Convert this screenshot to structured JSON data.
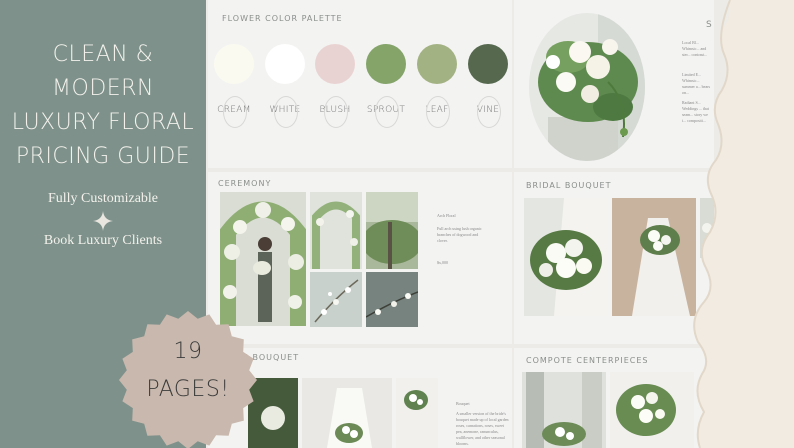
{
  "left_panel": {
    "title_lines": [
      "CLEAN & MODERN",
      "LUXURY FLORAL",
      "PRICING GUIDE"
    ],
    "tagline_1": "Fully Customizable",
    "tagline_2": "Book Luxury Clients",
    "background_color": "#7e918b"
  },
  "palette_page": {
    "heading": "FLOWER COLOR PALETTE",
    "swatches": [
      {
        "label": "CREAM",
        "color": "#fbfaf1"
      },
      {
        "label": "WHITE",
        "color": "#ffffff"
      },
      {
        "label": "BLUSH",
        "color": "#e9d3d2"
      },
      {
        "label": "SPROUT",
        "color": "#84a46a"
      },
      {
        "label": "LEAF",
        "color": "#a3b283"
      },
      {
        "label": "VINE",
        "color": "#56694f"
      }
    ]
  },
  "ceremony_page": {
    "heading": "CEREMONY",
    "caption_1": "Arch Floral",
    "caption_2": "Full arch using lush organic branches of dogwood and clover.",
    "caption_3": "$x,000"
  },
  "bridal_page": {
    "heading": "BRIDAL BOUQUET"
  },
  "maids_page": {
    "heading": "MAIDS BOUQUET",
    "caption_1": "Bouquet",
    "caption_2": "A smaller version of the bride's bouquet made up of local garden roses, carnations, roses, sweet pea, anemone, ranunculus, wallflower, and other seasonal blooms."
  },
  "centerpiece_page": {
    "heading": "COMPOTE CENTERPIECES"
  },
  "side_page": {
    "heading_fragment": "S",
    "text_1": "Local Bl... Whimsic... and ster... contrast...",
    "text_2": "Limited E... Whimsic... summer a... bears on...",
    "text_3": "Radiant S... Weddings ... that seam... story we i... compositi..."
  },
  "badge": {
    "line_1": "19",
    "line_2": "PAGES!",
    "color": "#c9b8ad"
  }
}
